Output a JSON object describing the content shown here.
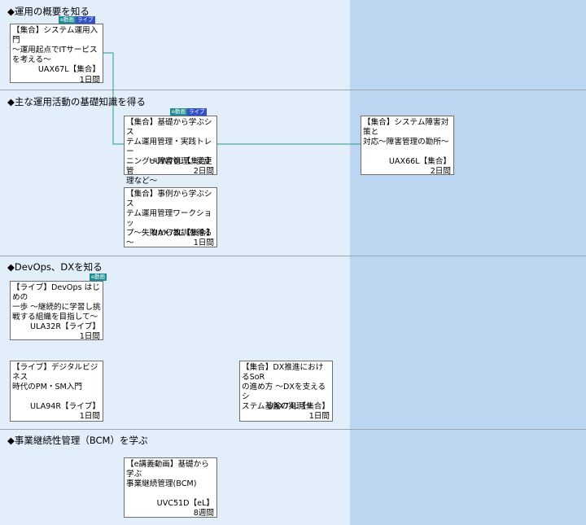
{
  "sections": [
    {
      "title": "◆運用の概要を知る"
    },
    {
      "title": "◆主な運用活動の基礎知識を得る"
    },
    {
      "title": "◆DevOps、DXを知る"
    },
    {
      "title": "◆事業継続性管理（BCM）を学ぶ"
    }
  ],
  "badges": {
    "e": "e動画",
    "live": "ライブ"
  },
  "courses": [
    {
      "title": "【集合】システム運用入門\n～運用起点でITサービス\nを考える～",
      "code": "UAX67L【集合】",
      "duration": "1日間"
    },
    {
      "title": "【集合】基礎から学ぶシス\nテム運用管理・実践トレー\nニング～障害管理、変更管\n理など～",
      "code": "UUW76L【集合】",
      "duration": "2日間"
    },
    {
      "title": "【集合】システム障害対策と\n対応～障害管理の勘所～",
      "code": "UAX66L【集合】",
      "duration": "2日間"
    },
    {
      "title": "【集合】事例から学ぶシス\nテム運用管理ワークショッ\nプ～失敗から教訓を得る～",
      "code": "UAX73L【集合】",
      "duration": "1日間"
    },
    {
      "title": "【ライブ】DevOps はじめの\n一歩 ～継続的に学習し挑\n戦する組織を目指して～",
      "code": "ULA32R【ライブ】",
      "duration": "1日間"
    },
    {
      "title": "【ライブ】デジタルビジネス\n時代のPM・SM入門",
      "code": "ULA94R【ライブ】",
      "duration": "1日間"
    },
    {
      "title": "【集合】DX推進におけるSoR\nの進め方 ～DXを支えるシ\nステム基盤の実現～",
      "code": "UAX74L【集合】",
      "duration": "1日間"
    },
    {
      "title": "【e講義動画】基礎から学ぶ\n事業継続管理(BCM)",
      "code": "UVC51D【eL】",
      "duration": "8週間"
    }
  ]
}
